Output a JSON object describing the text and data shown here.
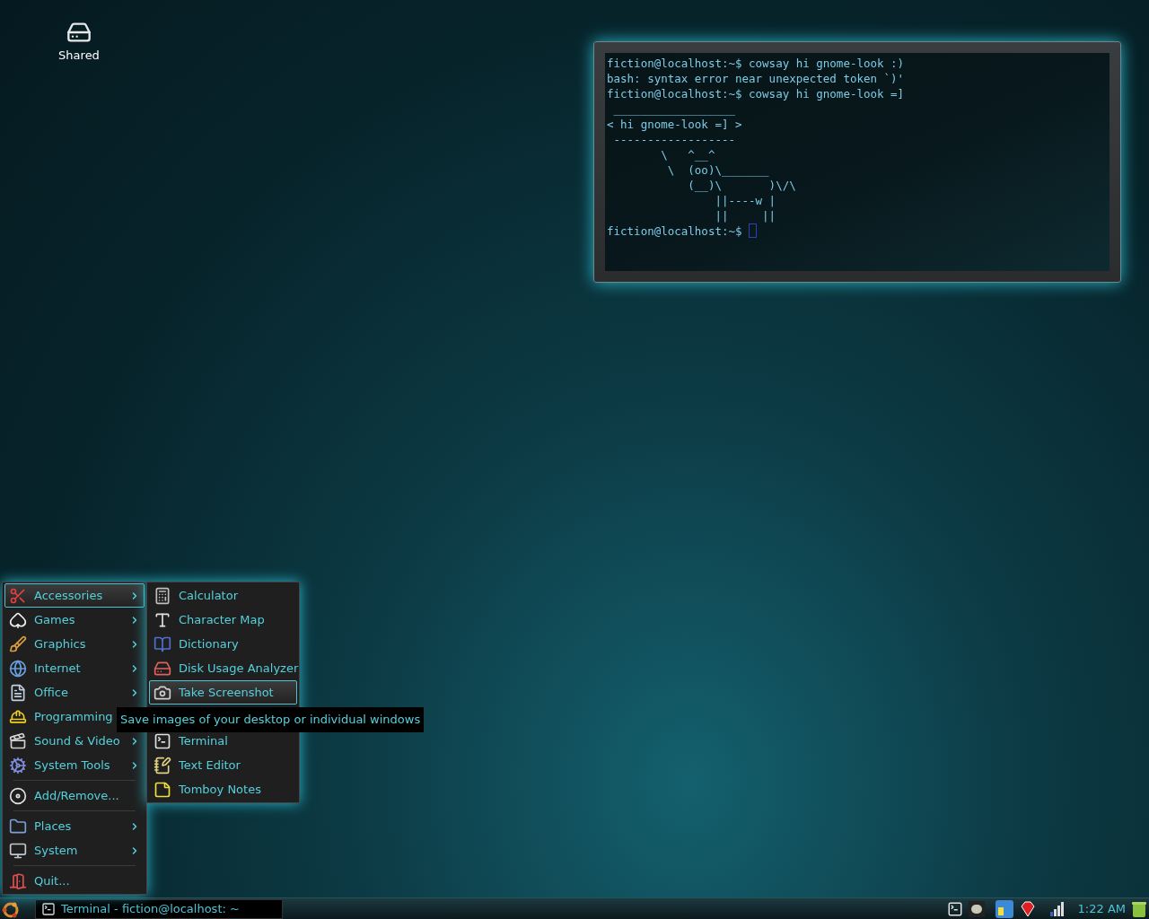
{
  "desktop_icons": [
    {
      "label": "Shared"
    }
  ],
  "terminal": {
    "lines": [
      "fiction@localhost:~$ cowsay hi gnome-look :)",
      "bash: syntax error near unexpected token `)'",
      "fiction@localhost:~$ cowsay hi gnome-look =]",
      " __________________",
      "< hi gnome-look =] >",
      " ------------------",
      "        \\   ^__^",
      "         \\  (oo)\\_______",
      "            (__)\\       )\\/\\",
      "                ||----w |",
      "                ||     ||",
      "fiction@localhost:~$ "
    ],
    "cursor": true
  },
  "menu": {
    "items": [
      {
        "kind": "submenu",
        "label": "Accessories",
        "selected": true
      },
      {
        "kind": "submenu",
        "label": "Games",
        "selected": false
      },
      {
        "kind": "submenu",
        "label": "Graphics",
        "selected": false
      },
      {
        "kind": "submenu",
        "label": "Internet",
        "selected": false
      },
      {
        "kind": "submenu",
        "label": "Office",
        "selected": false
      },
      {
        "kind": "submenu",
        "label": "Programming",
        "selected": false
      },
      {
        "kind": "submenu",
        "label": "Sound & Video",
        "selected": false
      },
      {
        "kind": "submenu",
        "label": "System Tools",
        "selected": false
      },
      {
        "kind": "separator"
      },
      {
        "kind": "launcher",
        "label": "Add/Remove...",
        "selected": false
      },
      {
        "kind": "separator"
      },
      {
        "kind": "submenu",
        "label": "Places",
        "selected": false
      },
      {
        "kind": "submenu",
        "label": "System",
        "selected": false
      },
      {
        "kind": "separator"
      },
      {
        "kind": "launcher",
        "label": "Quit...",
        "selected": false
      }
    ]
  },
  "submenu": {
    "items": [
      {
        "kind": "launcher",
        "label": "Calculator",
        "selected": false
      },
      {
        "kind": "launcher",
        "label": "Character Map",
        "selected": false
      },
      {
        "kind": "launcher",
        "label": "Dictionary",
        "selected": false
      },
      {
        "kind": "launcher",
        "label": "Disk Usage Analyzer",
        "selected": false
      },
      {
        "kind": "launcher",
        "label": "Take Screenshot",
        "selected": true
      },
      {
        "kind": "hidden"
      },
      {
        "kind": "launcher",
        "label": "Terminal",
        "selected": false
      },
      {
        "kind": "launcher",
        "label": "Text Editor",
        "selected": false
      },
      {
        "kind": "launcher",
        "label": "Tomboy Notes",
        "selected": false
      }
    ]
  },
  "tooltip": "Save images of your desktop or individual windows",
  "taskbar": {
    "tasks": [
      {
        "label": "Terminal - fiction@localhost: ~"
      }
    ],
    "clock": "1:22 AM"
  }
}
